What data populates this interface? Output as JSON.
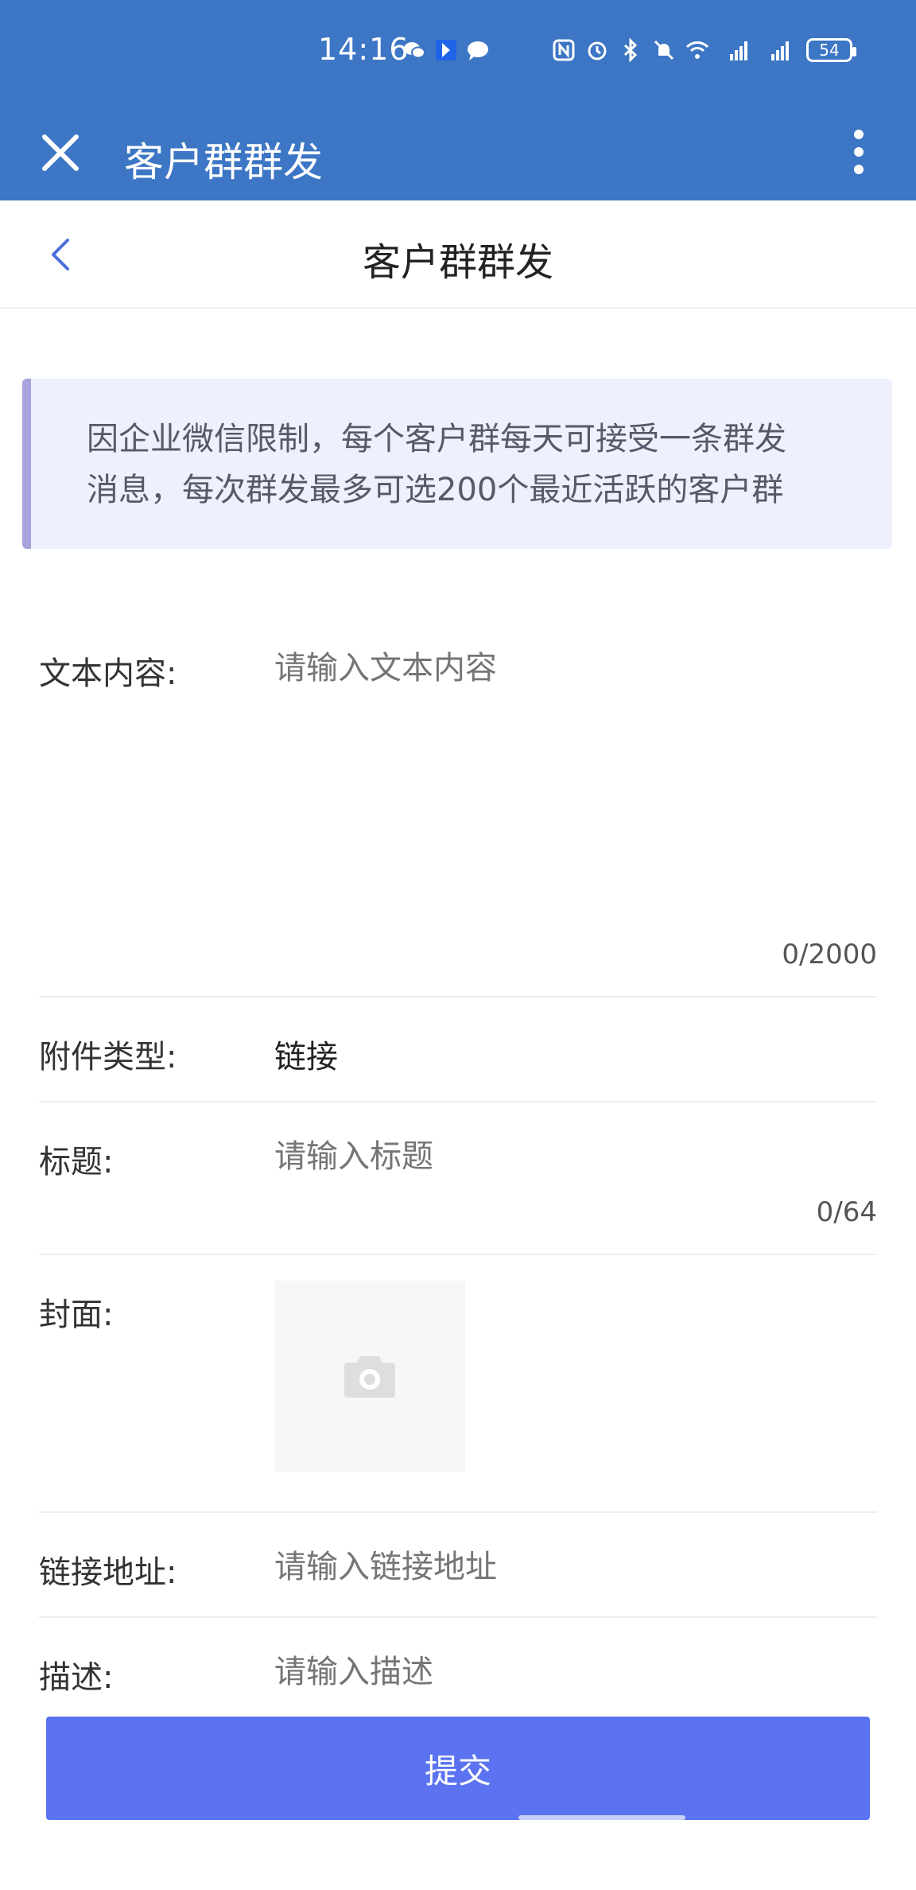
{
  "status_bar": {
    "time": "14:16",
    "battery": "54"
  },
  "app_header": {
    "title": "客户群群发"
  },
  "page": {
    "title": "客户群群发"
  },
  "notice": {
    "line1": "因企业微信限制，每个客户群每天可接受一条群发",
    "line2": "消息，每次群发最多可选200个最近活跃的客户群"
  },
  "form": {
    "text_content": {
      "label": "文本内容:",
      "placeholder": "请输入文本内容",
      "counter": "0/2000"
    },
    "attachment_type": {
      "label": "附件类型:",
      "value": "链接"
    },
    "title": {
      "label": "标题:",
      "placeholder": "请输入标题",
      "counter": "0/64"
    },
    "cover": {
      "label": "封面:"
    },
    "link_url": {
      "label": "链接地址:",
      "placeholder": "请输入链接地址"
    },
    "description": {
      "label": "描述:",
      "placeholder": "请输入描述"
    }
  },
  "submit": {
    "label": "提交"
  },
  "icons": {
    "close": "close-icon",
    "more": "more-vertical-icon",
    "back": "chevron-left-icon",
    "camera": "camera-icon"
  },
  "colors": {
    "header_blue": "#3c76c4",
    "submit_blue": "#5b73f0",
    "notice_bg": "#eef0fd",
    "notice_border": "#a8a3dc"
  }
}
